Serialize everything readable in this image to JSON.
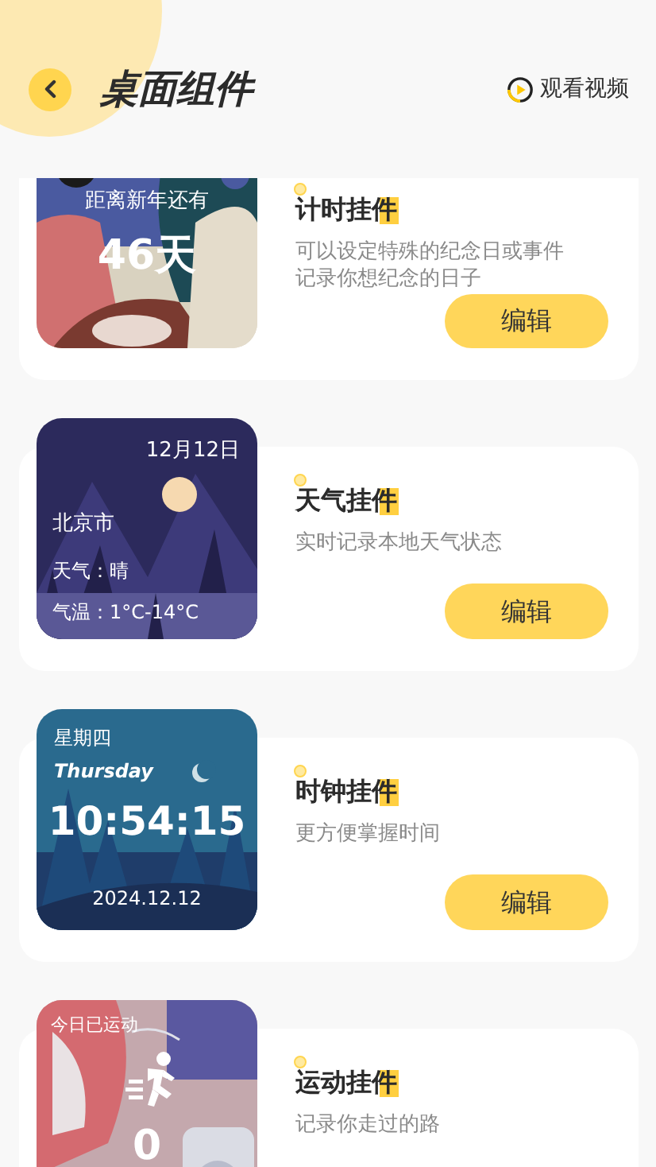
{
  "header": {
    "title": "桌面组件",
    "video_link": "观看视频"
  },
  "widgets": [
    {
      "title": "计时挂件",
      "description": "可以设定特殊的纪念日或事件记录你想纪念的日子",
      "button": "编辑",
      "preview": {
        "kind": "countdown",
        "label": "距离新年还有",
        "value": "46天"
      }
    },
    {
      "title": "天气挂件",
      "description": "实时记录本地天气状态",
      "button": "编辑",
      "preview": {
        "kind": "weather",
        "date": "12月12日",
        "city": "北京市",
        "weather": "天气：晴",
        "temperature": "气温：1°C-14°C"
      }
    },
    {
      "title": "时钟挂件",
      "description": "更方便掌握时间",
      "button": "编辑",
      "preview": {
        "kind": "clock",
        "weekday": "星期四",
        "weekday_en": "Thursday",
        "time": "10:54:15",
        "date": "2024.12.12"
      }
    },
    {
      "title": "运动挂件",
      "description": "记录你走过的路",
      "preview": {
        "kind": "sport",
        "label": "今日已运动",
        "value": "0"
      }
    }
  ]
}
